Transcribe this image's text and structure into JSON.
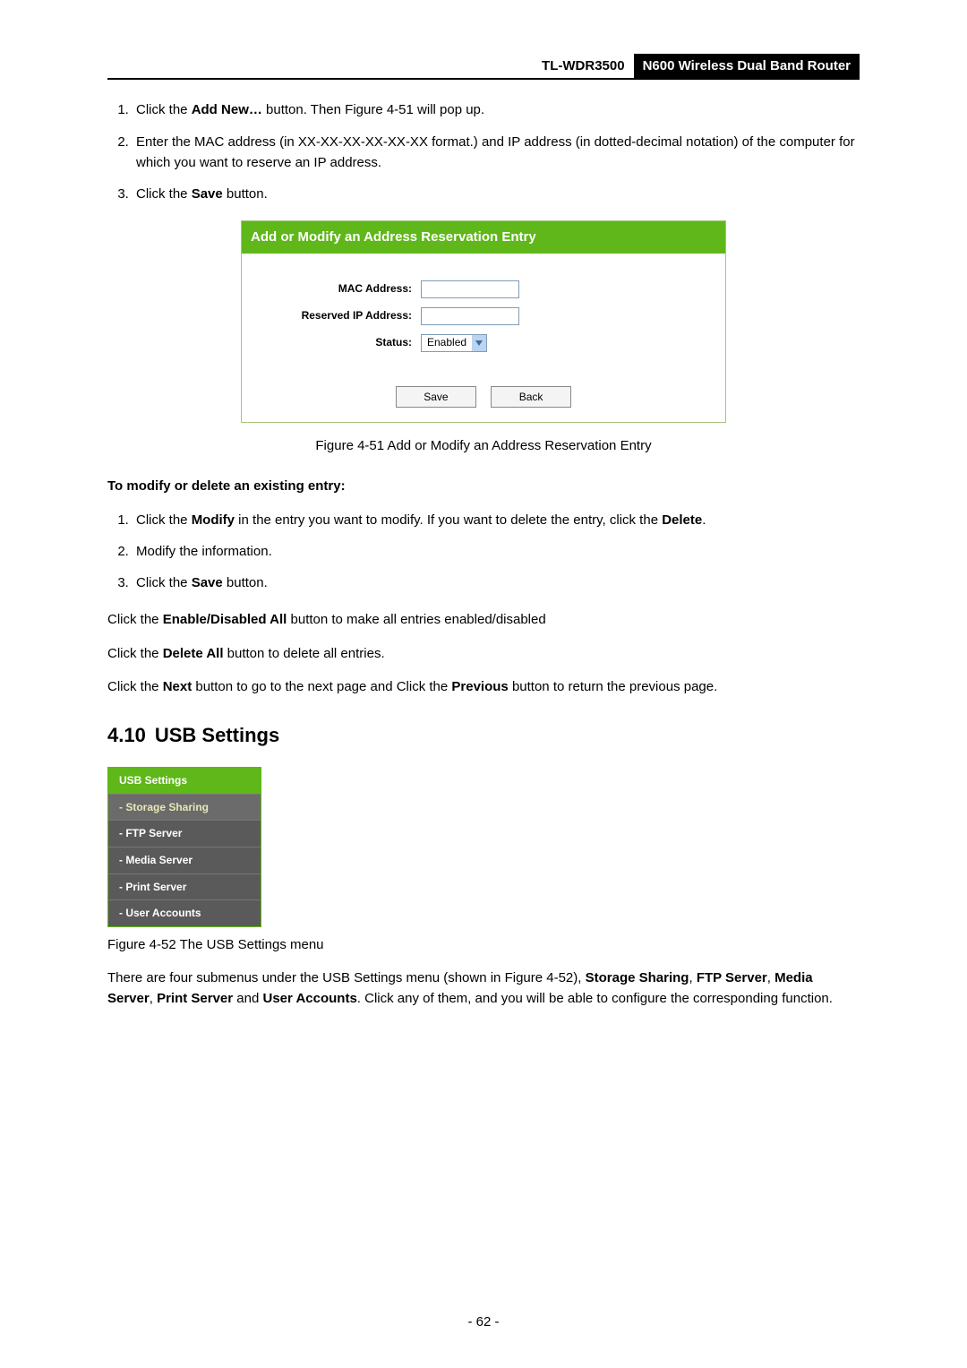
{
  "header": {
    "model": "TL-WDR3500",
    "description": "N600 Wireless Dual Band Router"
  },
  "steps_add": [
    {
      "pre": "Click the ",
      "bold": "Add New…",
      "post": " button. Then Figure 4-51 will pop up."
    },
    {
      "text": "Enter the MAC address (in XX-XX-XX-XX-XX-XX format.) and IP address (in dotted-decimal notation) of the computer for which you want to reserve an IP address."
    },
    {
      "pre": "Click the ",
      "bold": "Save",
      "post": " button."
    }
  ],
  "panel": {
    "title": "Add or Modify an Address Reservation Entry",
    "fields": {
      "mac_label": "MAC Address:",
      "ip_label": "Reserved IP Address:",
      "status_label": "Status:",
      "status_value": "Enabled"
    },
    "buttons": {
      "save": "Save",
      "back": "Back"
    }
  },
  "figure51": "Figure 4-51 Add or Modify an Address Reservation Entry",
  "modify_heading": "To modify or delete an existing entry:",
  "steps_modify": [
    {
      "pre": "Click the ",
      "bold": "Modify",
      "mid": " in the entry you want to modify. If you want to delete the entry, click the ",
      "bold2": "Delete",
      "post": "."
    },
    {
      "text": "Modify the information."
    },
    {
      "pre": "Click the ",
      "bold": "Save",
      "post": " button."
    }
  ],
  "para_enable": {
    "pre": "Click the ",
    "bold": "Enable/Disabled All",
    "post": " button to make all entries enabled/disabled"
  },
  "para_delete": {
    "pre": "Click the ",
    "bold": "Delete All",
    "post": " button to delete all entries."
  },
  "para_nextprev": {
    "pre": "Click the ",
    "b1": "Next",
    "mid": " button to go to the next page and Click the ",
    "b2": "Previous",
    "post": " button to return the previous page."
  },
  "section": {
    "num": "4.10",
    "title": "USB Settings"
  },
  "usb_menu": {
    "title": "USB Settings",
    "items": [
      {
        "label": "- Storage Sharing",
        "selected": true
      },
      {
        "label": "- FTP Server",
        "selected": false
      },
      {
        "label": "- Media Server",
        "selected": false
      },
      {
        "label": "- Print Server",
        "selected": false
      },
      {
        "label": "- User Accounts",
        "selected": false
      }
    ]
  },
  "figure52": "Figure 4-52 The USB Settings menu",
  "usb_para": {
    "pre": "There are four submenus under the USB Settings menu (shown in Figure 4-52), ",
    "b1": "Storage Sharing",
    "sep1": ", ",
    "b2": "FTP Server",
    "sep2": ", ",
    "b3": "Media Server",
    "sep3": ", ",
    "b4": "Print Server",
    "sep4": " and ",
    "b5": "User Accounts",
    "post": ". Click any of them, and you will be able to configure the corresponding function."
  },
  "page_number": "- 62 -"
}
